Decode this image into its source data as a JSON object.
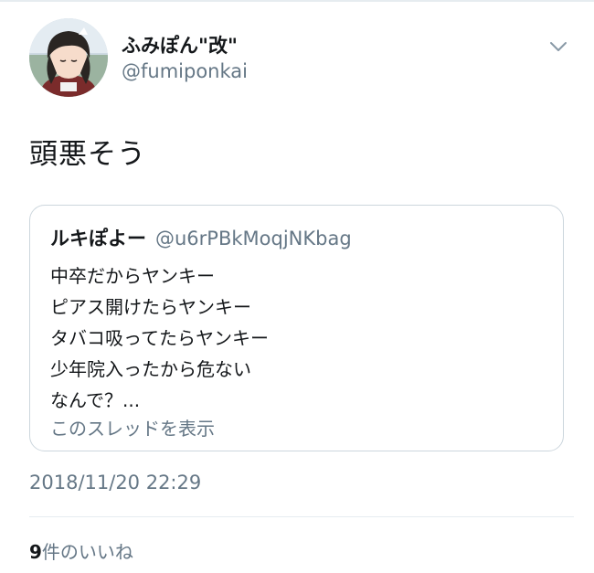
{
  "tweet": {
    "author": {
      "display_name": "ふみぽん\"改\"",
      "handle": "@fumiponkai",
      "avatar_icon": "anime-avatar-icon"
    },
    "menu_icon": "chevron-down-icon",
    "text": "頭悪そう",
    "quoted_tweet": {
      "author_name": "ルキぽよー",
      "author_handle": "@u6rPBkMoqjNKbag",
      "lines": [
        "中卒だからヤンキー",
        "ピアス開けたらヤンキー",
        "タバコ吸ってたらヤンキー",
        "少年院入ったから危ない",
        "なんで？..."
      ],
      "show_thread_label": "このスレッドを表示"
    },
    "timestamp": "2018/11/20 22:29",
    "likes": {
      "count": "9",
      "label": "件のいいね"
    }
  },
  "colors": {
    "text_primary": "#14171a",
    "text_secondary": "#657786",
    "border": "#ccd6dd",
    "divider": "#e6ecf0"
  }
}
